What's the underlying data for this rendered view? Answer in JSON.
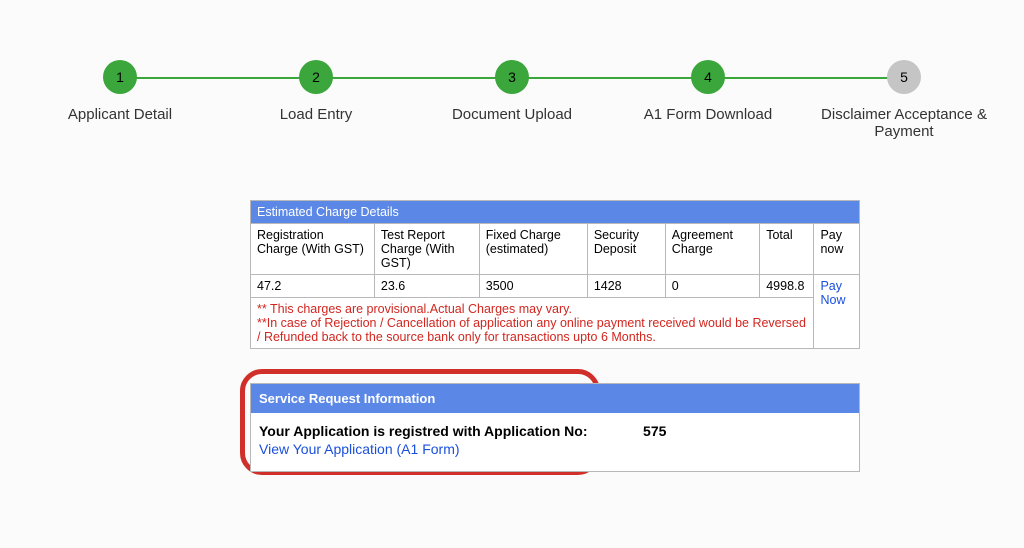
{
  "stepper": [
    {
      "num": "1",
      "label": "Applicant Detail",
      "active": true
    },
    {
      "num": "2",
      "label": "Load Entry",
      "active": true
    },
    {
      "num": "3",
      "label": "Document Upload",
      "active": true
    },
    {
      "num": "4",
      "label": "A1 Form Download",
      "active": true
    },
    {
      "num": "5",
      "label": "Disclaimer Acceptance & Payment",
      "active": false
    }
  ],
  "charges": {
    "heading": "Estimated Charge Details",
    "columns": [
      "Registration Charge (With GST)",
      "Test Report Charge (With GST)",
      "Fixed Charge (estimated)",
      "Security Deposit",
      "Agreement Charge",
      "Total",
      "Pay now"
    ],
    "row": {
      "reg": "47.2",
      "test": "23.6",
      "fixed": "3500",
      "sec": "1428",
      "agr": "0",
      "total": "4998.8",
      "paylink": "Pay Now"
    },
    "note1": "** This charges are provisional.Actual Charges may vary.",
    "note2": "**In case of Rejection / Cancellation of application any online payment received would be Reversed / Refunded back to the source bank only for transactions upto 6 Months."
  },
  "sr": {
    "heading": "Service Request Information",
    "reg_prefix": "Your Application is registred with Application No:",
    "appno": "575",
    "link": "View Your Application (A1 Form)"
  }
}
